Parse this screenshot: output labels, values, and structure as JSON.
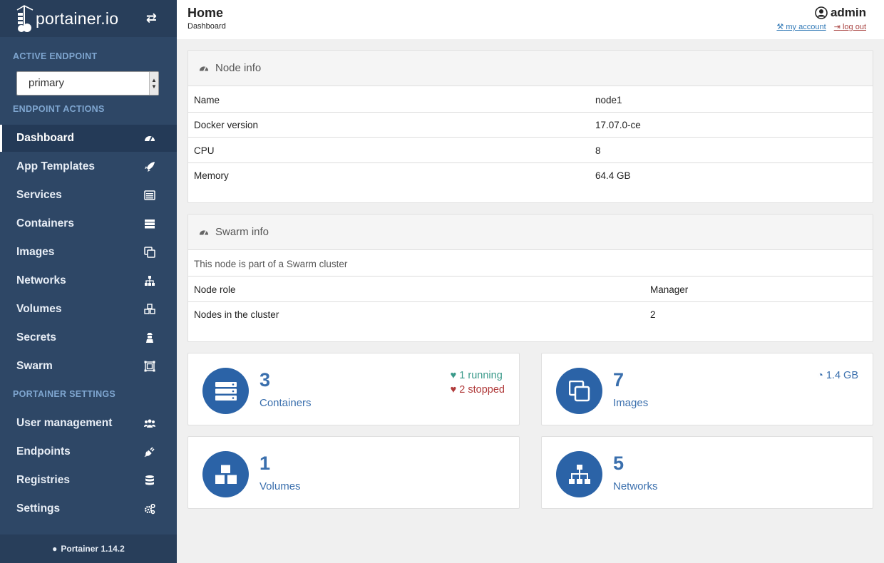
{
  "brand": {
    "name": "portainer.io"
  },
  "sidebar": {
    "active_endpoint_title": "ACTIVE ENDPOINT",
    "endpoint_selected": "primary",
    "endpoint_actions_title": "ENDPOINT ACTIONS",
    "items": [
      {
        "label": "Dashboard",
        "icon": "tachometer-icon"
      },
      {
        "label": "App Templates",
        "icon": "rocket-icon"
      },
      {
        "label": "Services",
        "icon": "list-alt-icon"
      },
      {
        "label": "Containers",
        "icon": "server-icon"
      },
      {
        "label": "Images",
        "icon": "clone-icon"
      },
      {
        "label": "Networks",
        "icon": "sitemap-icon"
      },
      {
        "label": "Volumes",
        "icon": "cubes-icon"
      },
      {
        "label": "Secrets",
        "icon": "user-secret-icon"
      },
      {
        "label": "Swarm",
        "icon": "object-group-icon"
      }
    ],
    "settings_title": "PORTAINER SETTINGS",
    "settings_items": [
      {
        "label": "User management",
        "icon": "users-icon"
      },
      {
        "label": "Endpoints",
        "icon": "plug-icon"
      },
      {
        "label": "Registries",
        "icon": "database-icon"
      },
      {
        "label": "Settings",
        "icon": "cogs-icon"
      }
    ],
    "footer": "Portainer 1.14.2"
  },
  "header": {
    "title": "Home",
    "breadcrumb": "Dashboard",
    "user": "admin",
    "my_account": "my account",
    "log_out": "log out"
  },
  "node_info": {
    "title": "Node info",
    "rows": [
      {
        "key": "Name",
        "value": "node1"
      },
      {
        "key": "Docker version",
        "value": "17.07.0-ce"
      },
      {
        "key": "CPU",
        "value": "8"
      },
      {
        "key": "Memory",
        "value": "64.4 GB"
      }
    ]
  },
  "swarm_info": {
    "title": "Swarm info",
    "note": "This node is part of a Swarm cluster",
    "rows": [
      {
        "key": "Node role",
        "value": "Manager"
      },
      {
        "key": "Nodes in the cluster",
        "value": "2"
      }
    ]
  },
  "stats": {
    "containers": {
      "count": "3",
      "label": "Containers",
      "running": "1 running",
      "stopped": "2 stopped"
    },
    "images": {
      "count": "7",
      "label": "Images",
      "size": "1.4 GB"
    },
    "volumes": {
      "count": "1",
      "label": "Volumes"
    },
    "networks": {
      "count": "5",
      "label": "Networks"
    }
  },
  "colors": {
    "sidebar": "#2e4766",
    "accent": "#2b63a7",
    "running": "#3a9a8a",
    "stopped": "#b03a3a"
  }
}
